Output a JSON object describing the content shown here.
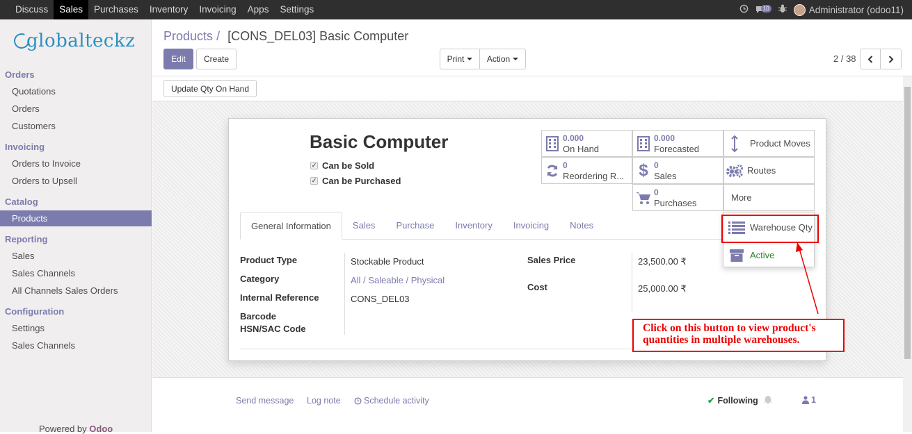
{
  "topbar": {
    "menu": [
      "Discuss",
      "Sales",
      "Purchases",
      "Inventory",
      "Invoicing",
      "Apps",
      "Settings"
    ],
    "active_menu": "Sales",
    "notification_count": "10",
    "user": "Administrator (odoo11)"
  },
  "sidebar": {
    "logo_text": "globalteckz",
    "sections": [
      {
        "title": "Orders",
        "items": [
          "Quotations",
          "Orders",
          "Customers"
        ]
      },
      {
        "title": "Invoicing",
        "items": [
          "Orders to Invoice",
          "Orders to Upsell"
        ]
      },
      {
        "title": "Catalog",
        "items": [
          "Products"
        ]
      },
      {
        "title": "Reporting",
        "items": [
          "Sales",
          "Sales Channels",
          "All Channels Sales Orders"
        ]
      },
      {
        "title": "Configuration",
        "items": [
          "Settings",
          "Sales Channels"
        ]
      }
    ],
    "active_item": "Products",
    "powered_prefix": "Powered by",
    "powered_brand": "Odoo"
  },
  "control_panel": {
    "breadcrumb_parent": "Products",
    "breadcrumb_sep": "/",
    "breadcrumb_current": "[CONS_DEL03] Basic Computer",
    "edit_label": "Edit",
    "create_label": "Create",
    "print_label": "Print",
    "action_label": "Action",
    "pager": "2 / 38",
    "update_qty_label": "Update Qty On Hand"
  },
  "product": {
    "name": "Basic Computer",
    "can_be_sold": "Can be Sold",
    "can_be_purchased": "Can be Purchased"
  },
  "smart_buttons": {
    "on_hand": {
      "value": "0.000",
      "label": "On Hand"
    },
    "forecasted": {
      "value": "0.000",
      "label": "Forecasted"
    },
    "product_moves": {
      "label": "Product Moves"
    },
    "reordering": {
      "value": "0",
      "label": "Reordering R..."
    },
    "sales": {
      "value": "0",
      "label": "Sales"
    },
    "routes": {
      "label": "Routes"
    },
    "purchases": {
      "value": "0",
      "label": "Purchases"
    },
    "more": {
      "label": "More"
    },
    "warehouse_qty": {
      "label": "Warehouse Qty"
    },
    "active": {
      "label": "Active"
    }
  },
  "tabs": [
    "General Information",
    "Sales",
    "Purchase",
    "Inventory",
    "Invoicing",
    "Notes"
  ],
  "active_tab": "General Information",
  "fields": {
    "product_type_label": "Product Type",
    "product_type": "Stockable Product",
    "category_label": "Category",
    "category": "All / Saleable / Physical",
    "internal_ref_label": "Internal Reference",
    "internal_ref": "CONS_DEL03",
    "barcode_label": "Barcode",
    "hsn_label": "HSN/SAC Code",
    "sales_price_label": "Sales Price",
    "sales_price": "23,500.00 ₹",
    "cost_label": "Cost",
    "cost": "25,000.00 ₹"
  },
  "annotation": {
    "line1": "Click on this button to view product's",
    "line2": "quantities in multiple warehouses."
  },
  "chatter": {
    "send_message": "Send message",
    "log_note": "Log note",
    "schedule_activity": "Schedule activity",
    "following": "Following",
    "followers_count": "1"
  },
  "colors": {
    "accent": "#7c7bad",
    "topbar": "#2f2f2f",
    "annotation": "#ee0000",
    "active_green": "#2e7d32"
  }
}
